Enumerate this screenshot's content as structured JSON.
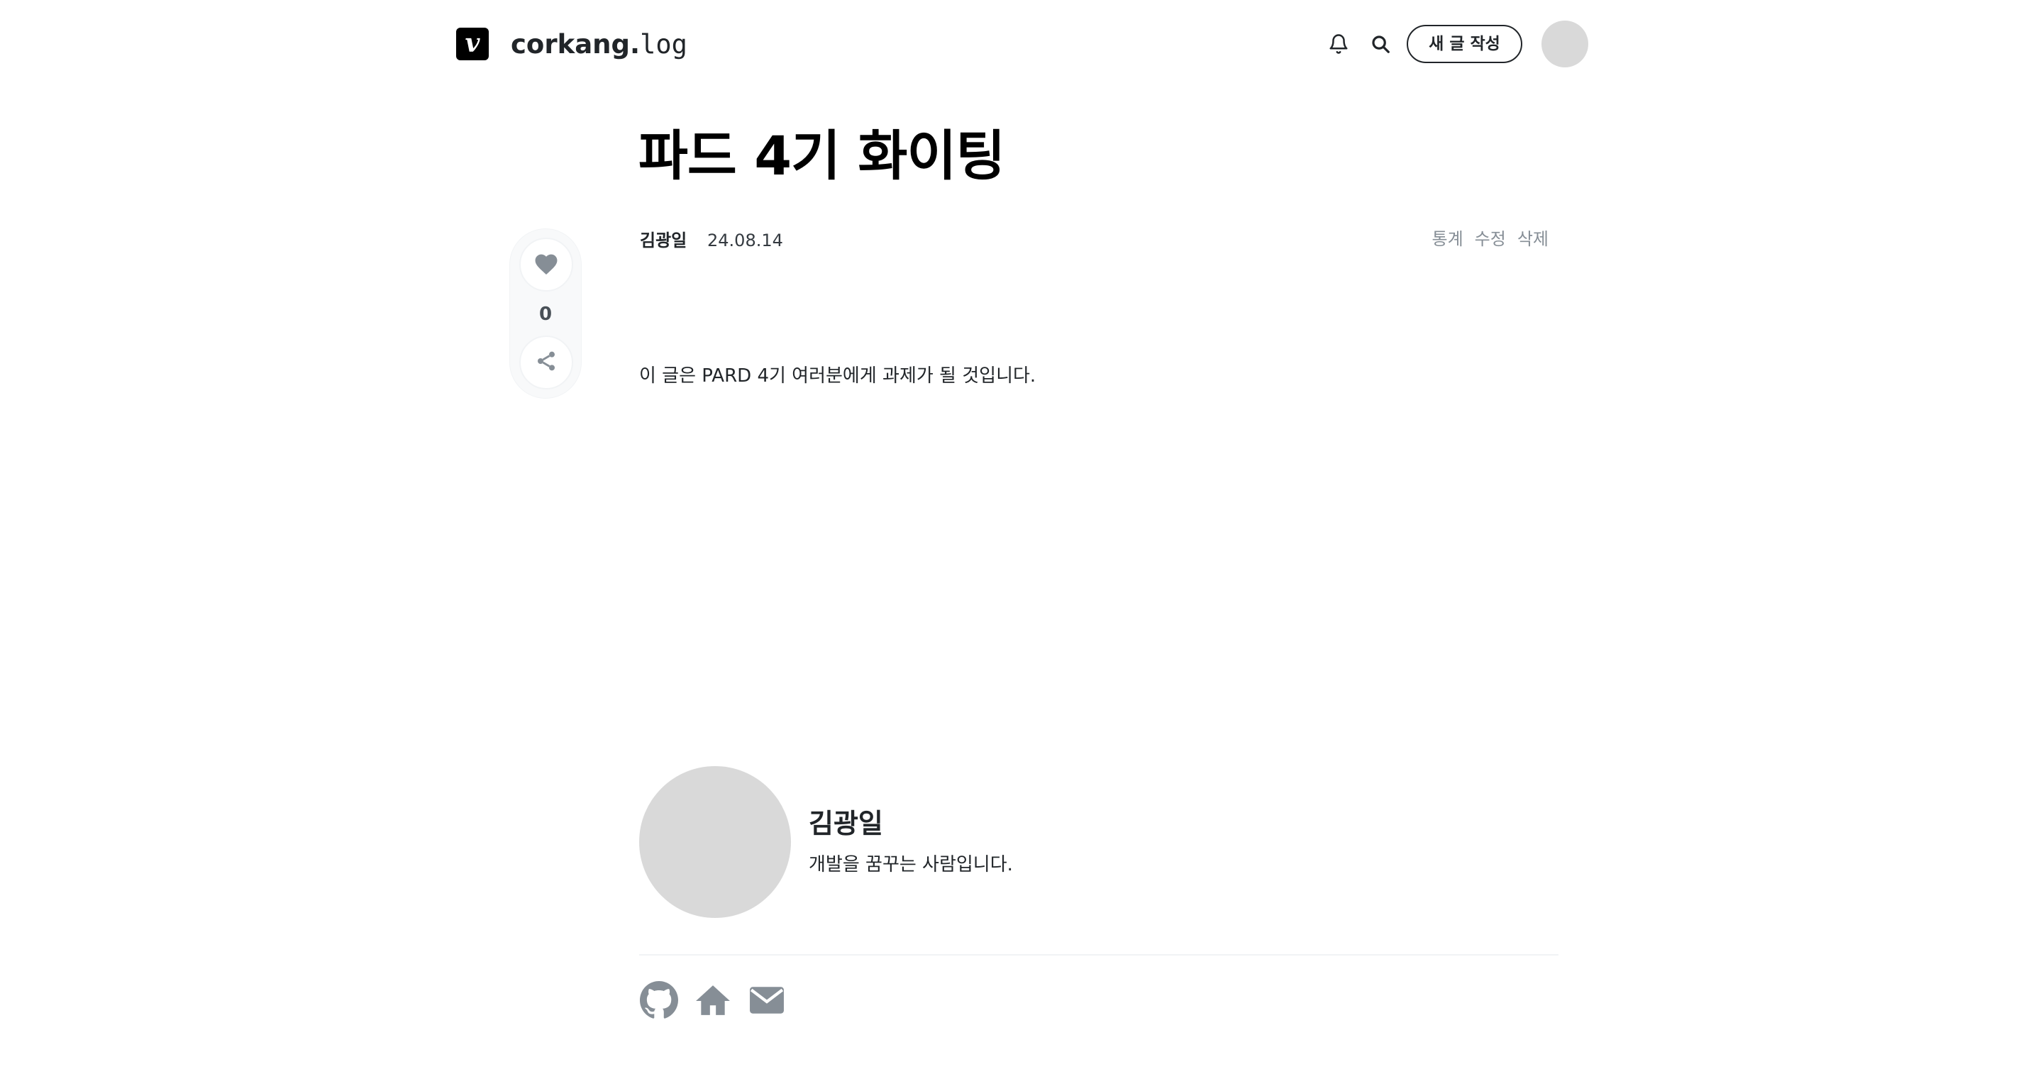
{
  "header": {
    "logo_letter": "v",
    "blog_name_prefix": "corkang.",
    "blog_name_suffix": "log",
    "notification_icon": "bell-icon",
    "search_icon": "search-icon",
    "new_post_label": "새 글 작성"
  },
  "post": {
    "title": "파드 4기 화이팅",
    "author": "김광일",
    "date": "24.08.14",
    "actions": [
      "통계",
      "수정",
      "삭제"
    ],
    "body": "이 글은 PARD 4기 여러분에게 과제가 될 것입니다."
  },
  "side_panel": {
    "like_icon": "heart-icon",
    "like_count": "0",
    "share_icon": "share-icon"
  },
  "profile": {
    "name": "김광일",
    "bio": "개발을 꿈꾸는 사람입니다.",
    "social_icons": [
      "github-icon",
      "home-icon",
      "mail-icon"
    ]
  },
  "colors": {
    "icon_gray": "#868e96",
    "avatar_placeholder": "#d9d9d9",
    "text": "#212529"
  }
}
